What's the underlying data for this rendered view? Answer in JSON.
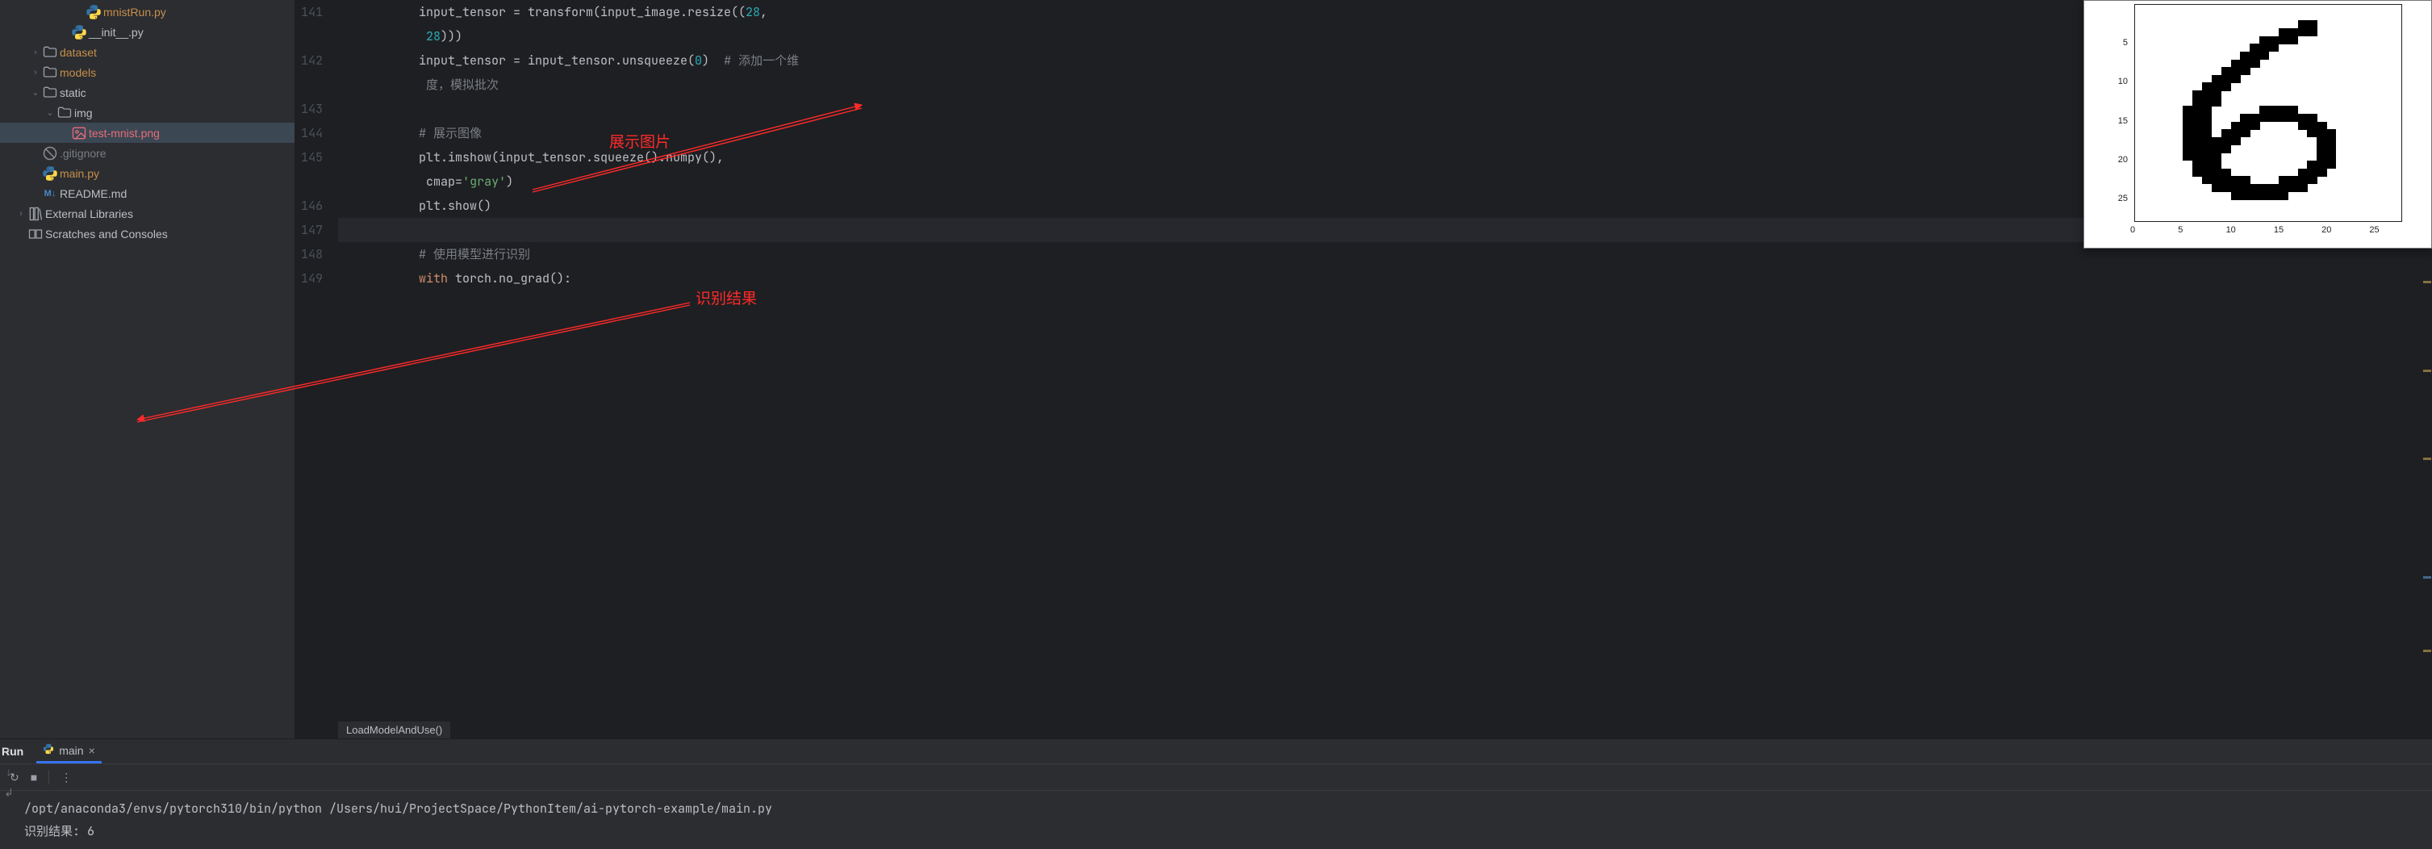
{
  "tree": {
    "items": [
      {
        "indent": 5,
        "icon": "py",
        "label": "mnistRun.py",
        "cls": "orange"
      },
      {
        "indent": 4,
        "icon": "py",
        "label": "__init__.py",
        "cls": ""
      },
      {
        "indent": 2,
        "icon": "folder",
        "label": "dataset",
        "cls": "orange",
        "chev": "right"
      },
      {
        "indent": 2,
        "icon": "folder",
        "label": "models",
        "cls": "orange",
        "chev": "right"
      },
      {
        "indent": 2,
        "icon": "folder",
        "label": "static",
        "cls": "",
        "chev": "down"
      },
      {
        "indent": 3,
        "icon": "folder",
        "label": "img",
        "cls": "",
        "chev": "down"
      },
      {
        "indent": 4,
        "icon": "img",
        "label": "test-mnist.png",
        "cls": "red",
        "selected": true
      },
      {
        "indent": 2,
        "icon": "ignore",
        "label": ".gitignore",
        "cls": "dim"
      },
      {
        "indent": 2,
        "icon": "py",
        "label": "main.py",
        "cls": "orange"
      },
      {
        "indent": 2,
        "icon": "md",
        "label": "README.md",
        "cls": ""
      },
      {
        "indent": 1,
        "icon": "lib",
        "label": "External Libraries",
        "cls": "",
        "chev": "right"
      },
      {
        "indent": 1,
        "icon": "scratch",
        "label": "Scratches and Consoles",
        "cls": ""
      }
    ]
  },
  "editor": {
    "breadcrumb": "LoadModelAndUse()",
    "lines": [
      {
        "n": 141,
        "html": "input_tensor = transform(input_image.resize((<span class='tk-num'>28</span>, "
      },
      {
        "n": "",
        "html": " <span class='tk-num'>28</span>)))"
      },
      {
        "n": 142,
        "html": "input_tensor = input_tensor.unsqueeze(<span class='tk-num'>0</span>)  <span class='tk-cmt'># 添加一个维</span>"
      },
      {
        "n": "",
        "html": " <span class='tk-cmt'>度，模拟批次</span>"
      },
      {
        "n": 143,
        "html": ""
      },
      {
        "n": 144,
        "html": "<span class='tk-cmt'># 展示图像</span>"
      },
      {
        "n": 145,
        "html": "plt.imshow(input_tensor.squeeze().numpy(),"
      },
      {
        "n": "",
        "html": " <span class='tk-param'>cmap</span>=<span class='tk-str'>'gray'</span>)"
      },
      {
        "n": 146,
        "html": "plt.show()"
      },
      {
        "n": 147,
        "html": "",
        "cursor": true
      },
      {
        "n": 148,
        "html": "<span class='tk-cmt'># 使用模型进行识别</span>"
      },
      {
        "n": 149,
        "html": "<span class='tk-kw'>with</span> torch.no_grad():"
      }
    ],
    "indent_prefix": "        "
  },
  "annotations": {
    "show_image": "展示图片",
    "result": "识别结果"
  },
  "run": {
    "title": "Run",
    "tab": "main",
    "console_lines": [
      "/opt/anaconda3/envs/pytorch310/bin/python /Users/hui/ProjectSpace/PythonItem/ai-pytorch-example/main.py",
      "识别结果: 6"
    ]
  },
  "chart_data": {
    "type": "heatmap",
    "title": "",
    "xlabel": "",
    "ylabel": "",
    "xlim": [
      0,
      27
    ],
    "ylim": [
      0,
      27
    ],
    "xticks": [
      0,
      5,
      10,
      15,
      20,
      25
    ],
    "yticks": [
      5,
      10,
      15,
      20,
      25
    ],
    "note": "28x28 grayscale MNIST-style image of digit 6 displayed via plt.imshow(cmap='gray'); origin at top-left; dark pixels ≈ digit stroke.",
    "digit_depicted": 6,
    "stroke_cells": [
      [
        2,
        17
      ],
      [
        2,
        18
      ],
      [
        3,
        15
      ],
      [
        3,
        16
      ],
      [
        3,
        17
      ],
      [
        3,
        18
      ],
      [
        4,
        13
      ],
      [
        4,
        14
      ],
      [
        4,
        15
      ],
      [
        4,
        16
      ],
      [
        5,
        12
      ],
      [
        5,
        13
      ],
      [
        5,
        14
      ],
      [
        6,
        11
      ],
      [
        6,
        12
      ],
      [
        6,
        13
      ],
      [
        7,
        10
      ],
      [
        7,
        11
      ],
      [
        7,
        12
      ],
      [
        8,
        9
      ],
      [
        8,
        10
      ],
      [
        8,
        11
      ],
      [
        9,
        8
      ],
      [
        9,
        9
      ],
      [
        9,
        10
      ],
      [
        10,
        7
      ],
      [
        10,
        8
      ],
      [
        10,
        9
      ],
      [
        11,
        6
      ],
      [
        11,
        7
      ],
      [
        11,
        8
      ],
      [
        12,
        6
      ],
      [
        12,
        7
      ],
      [
        12,
        8
      ],
      [
        13,
        5
      ],
      [
        13,
        6
      ],
      [
        13,
        7
      ],
      [
        13,
        13
      ],
      [
        13,
        14
      ],
      [
        13,
        15
      ],
      [
        13,
        16
      ],
      [
        14,
        5
      ],
      [
        14,
        6
      ],
      [
        14,
        7
      ],
      [
        14,
        11
      ],
      [
        14,
        12
      ],
      [
        14,
        13
      ],
      [
        14,
        14
      ],
      [
        14,
        15
      ],
      [
        14,
        16
      ],
      [
        14,
        17
      ],
      [
        14,
        18
      ],
      [
        15,
        5
      ],
      [
        15,
        6
      ],
      [
        15,
        7
      ],
      [
        15,
        10
      ],
      [
        15,
        11
      ],
      [
        15,
        12
      ],
      [
        15,
        17
      ],
      [
        15,
        18
      ],
      [
        15,
        19
      ],
      [
        16,
        5
      ],
      [
        16,
        6
      ],
      [
        16,
        7
      ],
      [
        16,
        9
      ],
      [
        16,
        10
      ],
      [
        16,
        11
      ],
      [
        16,
        18
      ],
      [
        16,
        19
      ],
      [
        16,
        20
      ],
      [
        17,
        5
      ],
      [
        17,
        6
      ],
      [
        17,
        7
      ],
      [
        17,
        8
      ],
      [
        17,
        9
      ],
      [
        17,
        10
      ],
      [
        17,
        19
      ],
      [
        17,
        20
      ],
      [
        18,
        5
      ],
      [
        18,
        6
      ],
      [
        18,
        7
      ],
      [
        18,
        8
      ],
      [
        18,
        9
      ],
      [
        18,
        19
      ],
      [
        18,
        20
      ],
      [
        19,
        5
      ],
      [
        19,
        6
      ],
      [
        19,
        7
      ],
      [
        19,
        8
      ],
      [
        19,
        19
      ],
      [
        19,
        20
      ],
      [
        20,
        6
      ],
      [
        20,
        7
      ],
      [
        20,
        8
      ],
      [
        20,
        18
      ],
      [
        20,
        19
      ],
      [
        20,
        20
      ],
      [
        21,
        6
      ],
      [
        21,
        7
      ],
      [
        21,
        8
      ],
      [
        21,
        9
      ],
      [
        21,
        17
      ],
      [
        21,
        18
      ],
      [
        21,
        19
      ],
      [
        22,
        7
      ],
      [
        22,
        8
      ],
      [
        22,
        9
      ],
      [
        22,
        10
      ],
      [
        22,
        11
      ],
      [
        22,
        15
      ],
      [
        22,
        16
      ],
      [
        22,
        17
      ],
      [
        22,
        18
      ],
      [
        23,
        8
      ],
      [
        23,
        9
      ],
      [
        23,
        10
      ],
      [
        23,
        11
      ],
      [
        23,
        12
      ],
      [
        23,
        13
      ],
      [
        23,
        14
      ],
      [
        23,
        15
      ],
      [
        23,
        16
      ],
      [
        23,
        17
      ],
      [
        24,
        10
      ],
      [
        24,
        11
      ],
      [
        24,
        12
      ],
      [
        24,
        13
      ],
      [
        24,
        14
      ],
      [
        24,
        15
      ]
    ]
  }
}
